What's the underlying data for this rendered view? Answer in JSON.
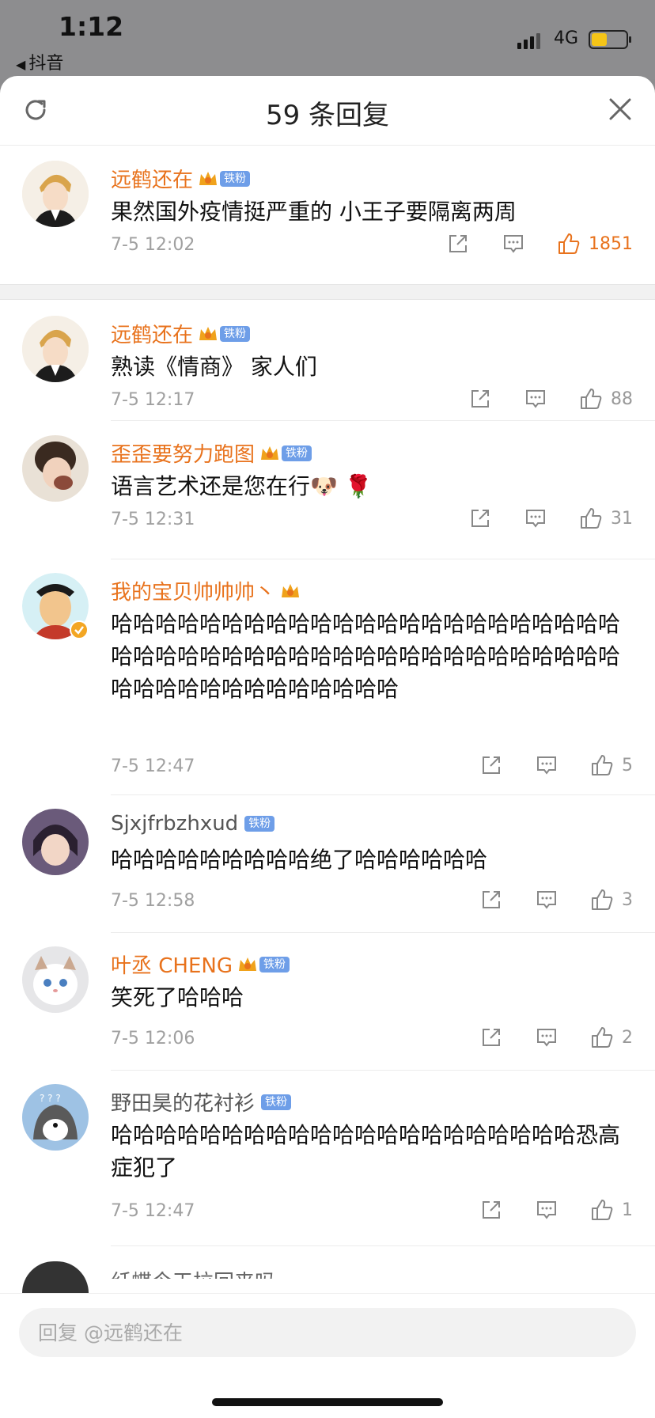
{
  "status_bar": {
    "time": "1:12",
    "back_app": "抖音",
    "network": "4G",
    "battery_level": 0.45
  },
  "sheet": {
    "title": "59 条回复",
    "refresh_icon": "refresh-icon",
    "close_icon": "close-icon"
  },
  "badge_label": "铁粉",
  "main_comment": {
    "name": "远鹤还在",
    "text": "果然国外疫情挺严重的 小王子要隔离两周",
    "time": "7-5 12:02",
    "likes": "1851"
  },
  "replies": [
    {
      "name": "远鹤还在",
      "text": "熟读《情商》 家人们",
      "time": "7-5 12:17",
      "likes": "88"
    },
    {
      "name": "歪歪要努力跑图",
      "text": "语言艺术还是您在行🐶 🌹",
      "time": "7-5 12:31",
      "likes": "31"
    },
    {
      "name": "我的宝贝帅帅帅丶",
      "text": "哈哈哈哈哈哈哈哈哈哈哈哈哈哈哈哈哈哈哈哈哈哈哈哈哈哈哈哈哈哈哈哈哈哈哈哈哈哈哈哈哈哈哈哈哈哈哈哈哈哈哈哈哈哈哈哈哈哈哈",
      "time": "7-5 12:47",
      "likes": "5"
    },
    {
      "name": "Sjxjfrbzhxud",
      "text": "哈哈哈哈哈哈哈哈哈绝了哈哈哈哈哈哈",
      "time": "7-5 12:58",
      "likes": "3"
    },
    {
      "name": "叶丞 CHENG",
      "text": "笑死了哈哈哈",
      "time": "7-5 12:06",
      "likes": "2"
    },
    {
      "name": "野田昊的花衬衫",
      "text": "哈哈哈哈哈哈哈哈哈哈哈哈哈哈哈哈哈哈哈哈哈恐高症犯了",
      "time": "7-5 12:47",
      "likes": "1"
    },
    {
      "name": "纤蝶今天拉回来吗"
    }
  ],
  "input": {
    "placeholder": "回复 @远鹤还在"
  },
  "colors": {
    "accent_orange": "#e8721c",
    "badge_blue": "#6e9ee8"
  }
}
